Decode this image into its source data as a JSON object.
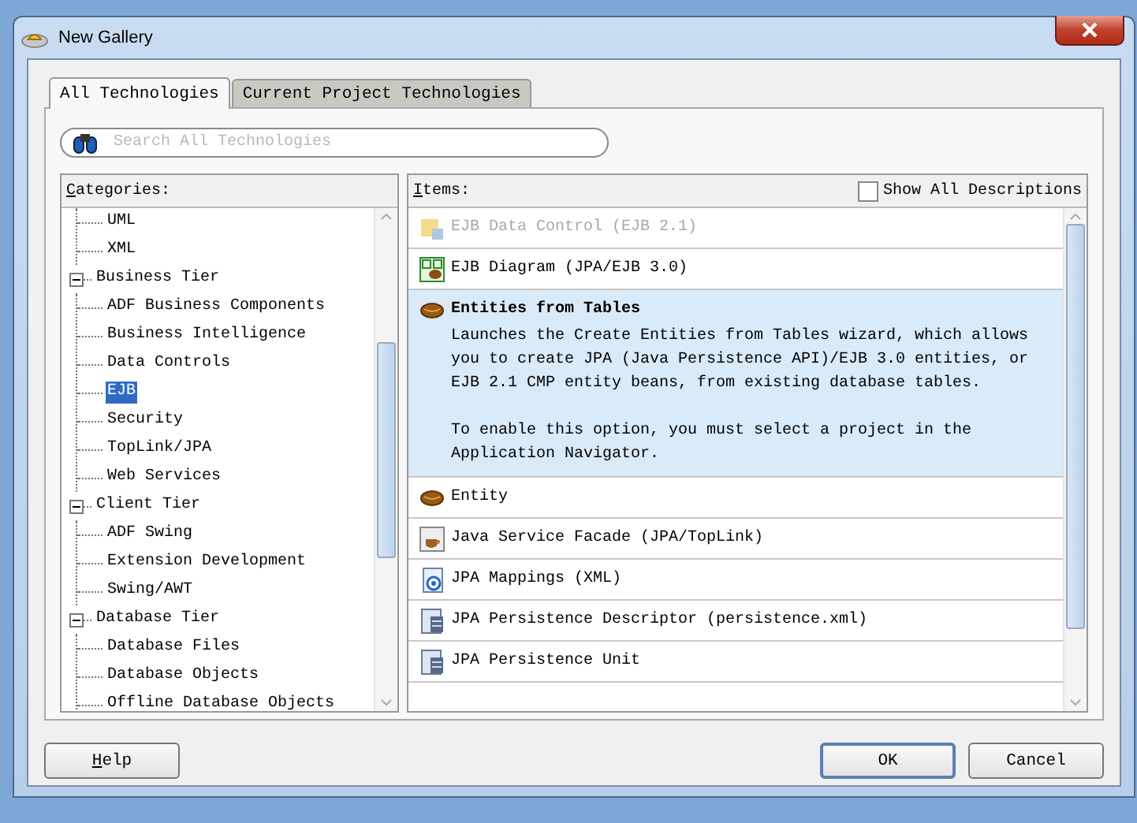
{
  "window": {
    "title": "New Gallery"
  },
  "tabs": [
    {
      "label": "All Technologies",
      "selected": true
    },
    {
      "label": "Current Project Technologies",
      "selected": false
    }
  ],
  "search": {
    "placeholder": "Search All Technologies"
  },
  "categories": {
    "heading": "Categories:",
    "tree": [
      {
        "children": [
          {
            "label": "UML",
            "selected": false
          },
          {
            "label": "XML",
            "selected": false
          }
        ]
      },
      {
        "label": "Business Tier",
        "expanded": true,
        "children": [
          {
            "label": "ADF Business Components",
            "selected": false
          },
          {
            "label": "Business Intelligence",
            "selected": false
          },
          {
            "label": "Data Controls",
            "selected": false
          },
          {
            "label": "EJB",
            "selected": true
          },
          {
            "label": "Security",
            "selected": false
          },
          {
            "label": "TopLink/JPA",
            "selected": false
          },
          {
            "label": "Web Services",
            "selected": false
          }
        ]
      },
      {
        "label": "Client Tier",
        "expanded": true,
        "children": [
          {
            "label": "ADF Swing",
            "selected": false
          },
          {
            "label": "Extension Development",
            "selected": false
          },
          {
            "label": "Swing/AWT",
            "selected": false
          }
        ]
      },
      {
        "label": "Database Tier",
        "expanded": true,
        "children": [
          {
            "label": "Database Files",
            "selected": false
          },
          {
            "label": "Database Objects",
            "selected": false
          },
          {
            "label": "Offline Database Objects",
            "selected": false
          }
        ]
      }
    ]
  },
  "items": {
    "heading": "Items:",
    "show_all_descriptions": {
      "label": "Show All Descriptions",
      "checked": false
    },
    "list": [
      {
        "kind": "datacontrol",
        "title": "EJB Data Control (EJB 2.1)",
        "disabled": true,
        "selected": false
      },
      {
        "kind": "diagram",
        "title": "EJB Diagram (JPA/EJB 3.0)",
        "disabled": false,
        "selected": false
      },
      {
        "kind": "bean",
        "title": "Entities from Tables",
        "disabled": false,
        "selected": true,
        "description": [
          "Launches the Create Entities from Tables wizard, which allows you to create JPA (Java Persistence API)/EJB 3.0 entities, or EJB 2.1 CMP entity beans, from existing database tables.",
          "To enable this option, you must select a project in the Application Navigator."
        ]
      },
      {
        "kind": "bean",
        "title": "Entity",
        "disabled": false,
        "selected": false
      },
      {
        "kind": "facade",
        "title": "Java Service Facade (JPA/TopLink)",
        "disabled": false,
        "selected": false
      },
      {
        "kind": "mappings",
        "title": "JPA Mappings (XML)",
        "disabled": false,
        "selected": false
      },
      {
        "kind": "persistence",
        "title": "JPA Persistence Descriptor (persistence.xml)",
        "disabled": false,
        "selected": false
      },
      {
        "kind": "persistence",
        "title": "JPA Persistence Unit",
        "disabled": false,
        "selected": false
      }
    ]
  },
  "buttons": {
    "help": "Help",
    "ok": "OK",
    "cancel": "Cancel"
  }
}
